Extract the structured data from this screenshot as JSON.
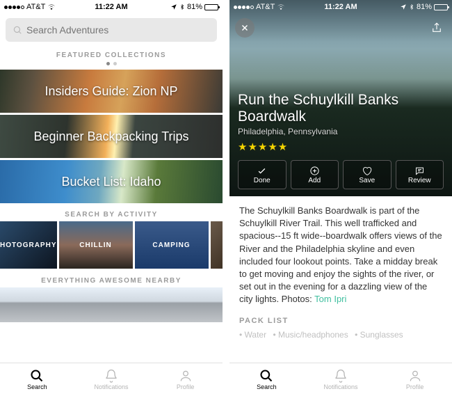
{
  "status": {
    "carrier": "AT&T",
    "time": "11:22 AM",
    "battery": "81%"
  },
  "left": {
    "search_placeholder": "Search Adventures",
    "featured_hdr": "FEATURED COLLECTIONS",
    "collections": [
      "Insiders Guide: Zion NP",
      "Beginner Backpacking Trips",
      "Bucket List: Idaho"
    ],
    "activity_hdr": "SEARCH BY ACTIVITY",
    "activities": [
      "HOTOGRAPHY",
      "CHILLIN",
      "CAMPING"
    ],
    "nearby_hdr": "EVERYTHING AWESOME NEARBY"
  },
  "right": {
    "title": "Run the Schuylkill Banks Boardwalk",
    "location": "Philadelphia, Pennsylvania",
    "rating": 5,
    "actions": {
      "done": "Done",
      "add": "Add",
      "save": "Save",
      "review": "Review"
    },
    "description": "The Schuylkill Banks Boardwalk is part of the Schuylkill River Trail. This well trafficked and spacious--15 ft wide--boardwalk offers views of the River and the Philadelphia skyline and even included four lookout points. Take a midday break to get moving and enjoy the sights of the river, or set out in the evening for a dazzling view of the city lights.   Photos: ",
    "photo_credit": "Tom Ipri",
    "pack_hdr": "PACK LIST",
    "pack_items": [
      "Water",
      "Music/headphones",
      "Sunglasses"
    ]
  },
  "tabs": {
    "search": "Search",
    "notifications": "Notifications",
    "profile": "Profile"
  }
}
